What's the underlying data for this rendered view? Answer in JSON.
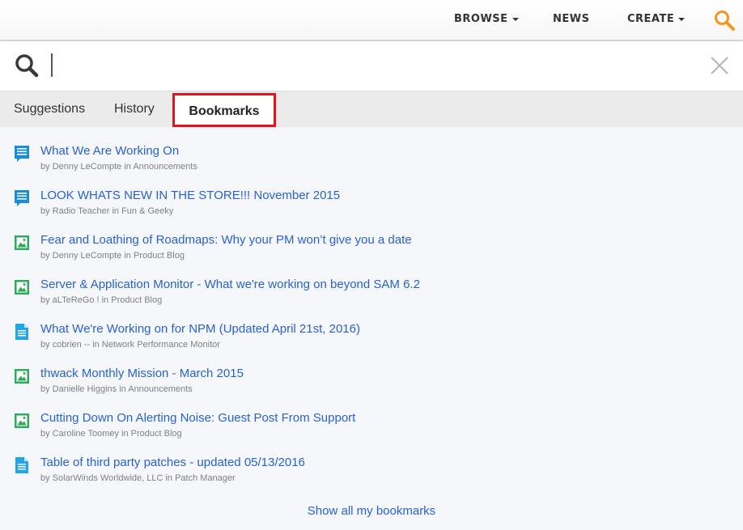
{
  "nav": {
    "browse": "BROWSE",
    "news": "NEWS",
    "create": "CREATE",
    "search_icon_color": "#f7941e"
  },
  "search": {
    "value": "",
    "placeholder": ""
  },
  "tabs": {
    "suggestions": "Suggestions",
    "history": "History",
    "bookmarks": "Bookmarks",
    "selected": "Bookmarks",
    "highlight_color": "#e5141c"
  },
  "bookmarks": [
    {
      "icon": "discussion-icon",
      "title": "What We Are Working On",
      "meta": "by Denny LeCompte in Announcements"
    },
    {
      "icon": "discussion-icon",
      "title": "LOOK WHATS NEW IN THE STORE!!! November 2015",
      "meta": "by Radio Teacher in Fun & Geeky"
    },
    {
      "icon": "blog-post-icon",
      "title": "Fear and Loathing of Roadmaps: Why your PM won’t give you a date",
      "meta": "by Denny LeCompte in Product Blog"
    },
    {
      "icon": "blog-post-icon",
      "title": "Server & Application Monitor - What we're working on beyond SAM 6.2",
      "meta": "by aLTeReGo ! in Product Blog"
    },
    {
      "icon": "document-icon",
      "title": "What We're Working on for NPM (Updated April 21st, 2016)",
      "meta": "by cobrien -- in Network Performance Monitor"
    },
    {
      "icon": "blog-post-icon",
      "title": "thwack Monthly Mission - March 2015",
      "meta": "by Danielle Higgins in Announcements"
    },
    {
      "icon": "blog-post-icon",
      "title": "Cutting Down On Alerting Noise: Guest Post From Support",
      "meta": "by Caroline Toomey in Product Blog"
    },
    {
      "icon": "document-icon",
      "title": "Table of third party patches - updated 05/13/2016",
      "meta": "by SolarWinds Worldwide, LLC in Patch Manager"
    }
  ],
  "show_all": "Show all my bookmarks",
  "colors": {
    "link": "#2762d2",
    "discussion": "#1a8cdc",
    "blog": "#2eaa5b",
    "document": "#23a6e8"
  }
}
